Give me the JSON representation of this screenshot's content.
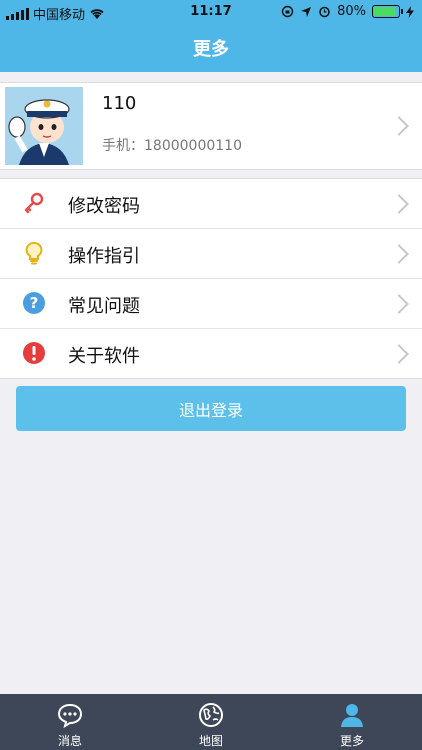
{
  "status_bar": {
    "carrier": "中国移动",
    "time": "11:17",
    "battery_pct": "80%",
    "battery_level": 0.8
  },
  "header": {
    "title": "更多"
  },
  "profile": {
    "name": "110",
    "phone": "手机：18000000110"
  },
  "menu": [
    {
      "label": "修改密码",
      "icon": "key-icon"
    },
    {
      "label": "操作指引",
      "icon": "lightbulb-icon"
    },
    {
      "label": "常见问题",
      "icon": "help-icon"
    },
    {
      "label": "关于软件",
      "icon": "info-icon"
    }
  ],
  "logout": {
    "label": "退出登录"
  },
  "tabs": [
    {
      "label": "消息",
      "icon": "message-icon"
    },
    {
      "label": "地图",
      "icon": "globe-icon"
    },
    {
      "label": "更多",
      "icon": "user-icon",
      "active": true
    }
  ],
  "colors": {
    "header_bg": "#4fb7e7",
    "logout_bg": "#5cc0ea",
    "tabbar_bg": "#3e4757"
  }
}
